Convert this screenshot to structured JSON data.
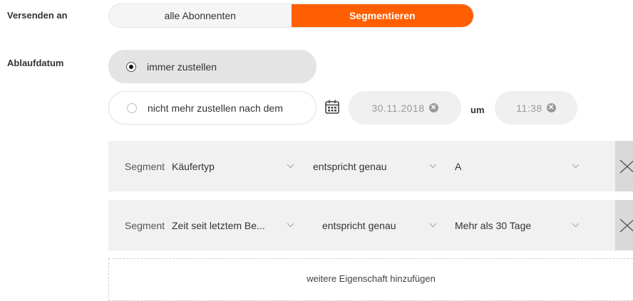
{
  "send_to": {
    "label": "Versenden an",
    "options": [
      "alle Abonnenten",
      "Segmentieren"
    ],
    "selected": "Segmentieren"
  },
  "expiry": {
    "label": "Ablaufdatum",
    "option_always": "immer zustellen",
    "option_until": "nicht mehr zustellen nach dem",
    "selected": "immer zustellen",
    "date": "30.11.2018",
    "at_label": "um",
    "time": "11:38"
  },
  "segments": [
    {
      "label": "Segment",
      "property": "Käufertyp",
      "operator": "entspricht genau",
      "value": "A"
    },
    {
      "label": "Segment",
      "property": "Zeit seit letztem Be...",
      "operator": "entspricht genau",
      "value": "Mehr als 30 Tage"
    }
  ],
  "add_property_label": "weitere Eigenschaft hinzufügen",
  "colors": {
    "accent": "#ff5f00",
    "row_bg": "#f1f1f1",
    "pill_selected": "#e4e4e4"
  },
  "icons": {
    "calendar": "calendar-icon",
    "clear": "clear-icon",
    "chevron": "chevron-down-icon",
    "delete": "close-icon"
  }
}
